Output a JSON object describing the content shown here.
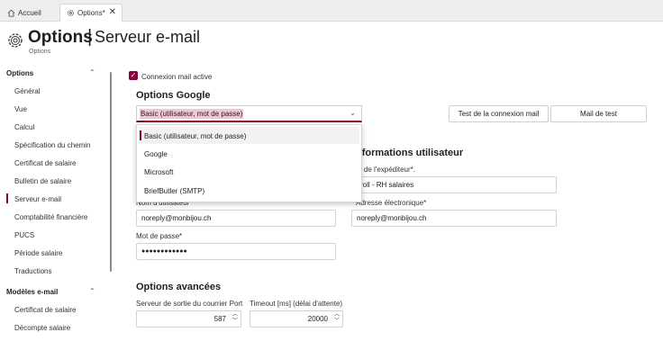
{
  "tabs": [
    {
      "label": "Accueil",
      "icon": "home-icon"
    },
    {
      "label": "Options*",
      "icon": "gear-icon"
    }
  ],
  "header": {
    "title": "Options",
    "separator": "|",
    "subtitle": "Serveur e-mail",
    "breadcrumb": "Options"
  },
  "sidebar": {
    "groups": [
      {
        "label": "Options",
        "items": [
          "Général",
          "Vue",
          "Calcul",
          "Spécification du chemin",
          "Certificat de salaire",
          "Bulletin de salaire",
          "Serveur e-mail",
          "Comptabilité financière",
          "PUCS",
          "Période salaire",
          "Traductions"
        ]
      },
      {
        "label": "Modèles e-mail",
        "items": [
          "Certificat de salaire",
          "Décompte salaire"
        ]
      }
    ],
    "active_item": "Serveur e-mail"
  },
  "main": {
    "active_checkbox_label": "Connexion mail active",
    "google_section": "Options Google",
    "auth_select": {
      "value": "Basic (utilisateur, mot de passe)",
      "options": [
        "Basic (utilisateur, mot de passe)",
        "Google",
        "Microsoft",
        "BriefButler (SMTP)"
      ]
    },
    "test_connection_btn": "Test de la connexion mail",
    "test_mail_btn": "Mail de test",
    "user_info_section": "nformations utilisateur",
    "sender_name_label": "m de l'expéditeur*.",
    "sender_name_value": "yroll - RH salaires",
    "username_label": "Nom d'utilisateur*",
    "username_value": "noreply@monbijou.ch",
    "email_label": "Adresse électronique*",
    "email_value": "noreply@monbijou.ch",
    "password_label": "Mot de passe*",
    "password_value": "●●●●●●●●●●●●",
    "advanced_section": "Options avancées",
    "port_label": "Serveur de sortie du courrier Port",
    "port_value": "587",
    "timeout_label": "Timeout [ms] (délai d'attente)",
    "timeout_value": "20000"
  },
  "colors": {
    "accent": "#8a0038",
    "highlight": "#f3c5d6"
  }
}
